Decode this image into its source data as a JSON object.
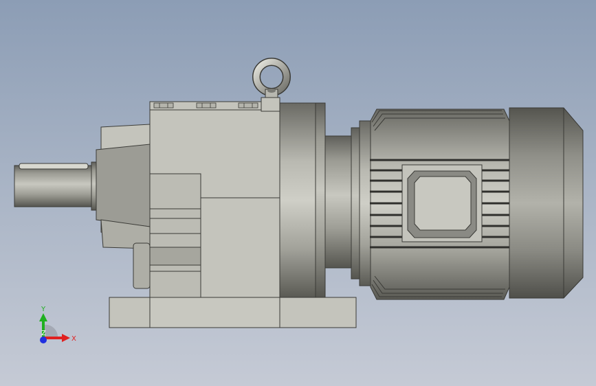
{
  "viewport": {
    "background_top": "#8c9db5",
    "background_bottom": "#c5cad5"
  },
  "model": {
    "body_color": "#c4c4bc",
    "edge_color": "#3a3a36",
    "parts": [
      "lifting-eye",
      "output-shaft",
      "gear-housing",
      "adapter-flange",
      "motor-frame",
      "terminal-box",
      "fan-cover",
      "base-foot"
    ]
  },
  "triad": {
    "x_label": "X",
    "y_label": "Y",
    "z_label": "Z",
    "x_color": "#e02020",
    "y_color": "#20b020",
    "z_color": "#2030e0"
  }
}
